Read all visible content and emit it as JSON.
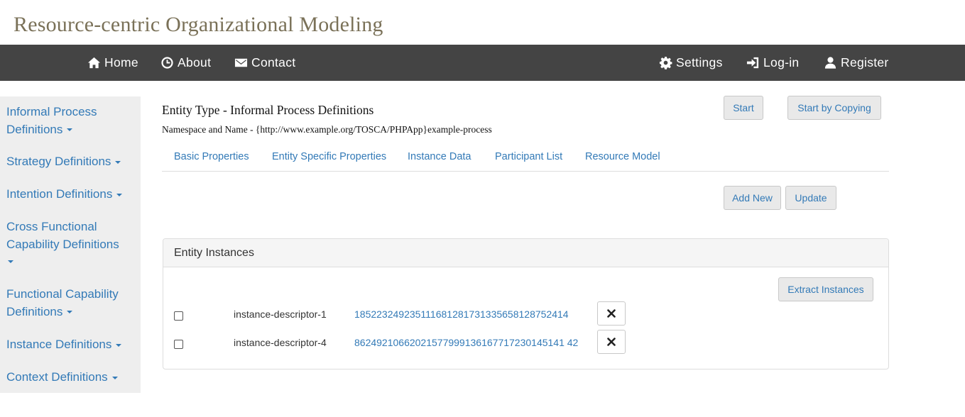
{
  "site": {
    "title": "Resource-centric Organizational Modeling"
  },
  "nav": {
    "home": "Home",
    "about": "About",
    "contact": "Contact",
    "settings": "Settings",
    "login": "Log-in",
    "register": "Register"
  },
  "sidebar": {
    "items": [
      {
        "label": "Informal Process Definitions"
      },
      {
        "label": "Strategy Definitions"
      },
      {
        "label": "Intention Definitions"
      },
      {
        "label": "Cross Functional Capability Definitions"
      },
      {
        "label": "Functional Capability Definitions"
      },
      {
        "label": "Instance Definitions"
      },
      {
        "label": "Context Definitions"
      }
    ]
  },
  "header": {
    "entity_type": "Entity Type - Informal Process Definitions",
    "namespace": "Namespace and Name - {http://www.example.org/TOSCA/PHPApp}example-process",
    "start_label": "Start",
    "copy_label": "Start by Copying"
  },
  "tabs": [
    {
      "label": "Basic Properties"
    },
    {
      "label": "Entity Specific Properties"
    },
    {
      "label": "Instance Data"
    },
    {
      "label": "Participant List"
    },
    {
      "label": "Resource Model"
    }
  ],
  "actions": {
    "add_new": "Add New",
    "update": "Update"
  },
  "instances": {
    "heading": "Entity Instances",
    "extract_label": "Extract Instances",
    "rows": [
      {
        "name": "instance-descriptor-1",
        "id": "185223249235111681281731335658128752414",
        "checked": false
      },
      {
        "name": "instance-descriptor-4",
        "id": "86249210662021577999136167717230145141 42",
        "checked": false
      }
    ]
  },
  "icons": {
    "home": "home-icon",
    "about": "clock-icon",
    "contact": "envelope-icon",
    "settings": "gear-icon",
    "login": "log-in-icon",
    "register": "user-icon",
    "delete": "close-icon"
  },
  "colors": {
    "navbar": "#444444",
    "link": "#337ab7",
    "title": "#7a7158",
    "sidebar_bg": "#eeeeee"
  }
}
